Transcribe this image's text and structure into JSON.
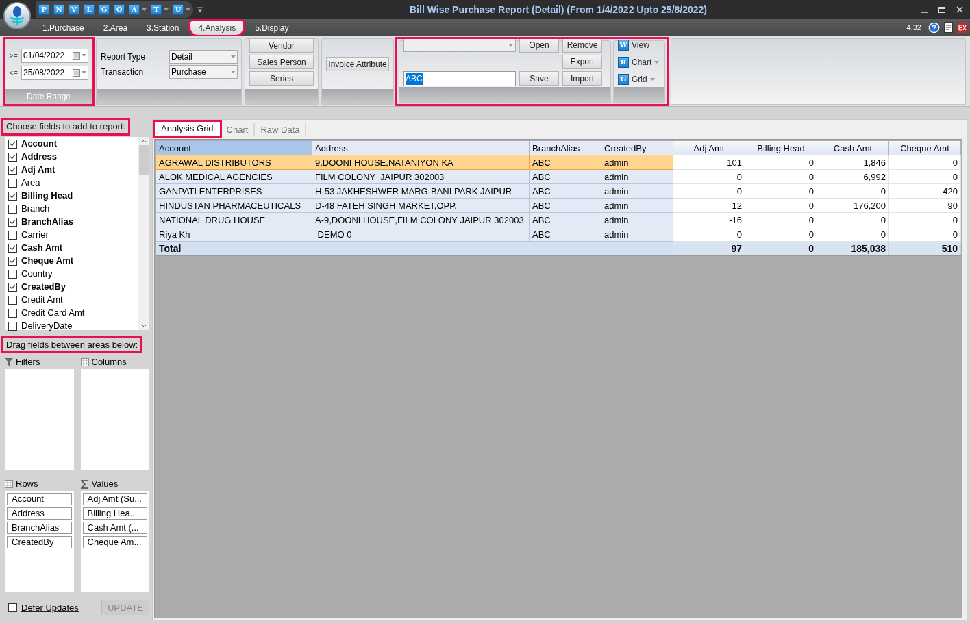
{
  "window": {
    "title": "Bill Wise Purchase Report (Detail) (From 1/4/2022 Upto 25/8/2022)",
    "version": "4.32"
  },
  "quick_access": [
    {
      "letter": "P",
      "dropdown": false
    },
    {
      "letter": "N",
      "dropdown": false
    },
    {
      "letter": "V",
      "dropdown": false
    },
    {
      "letter": "L",
      "dropdown": false
    },
    {
      "letter": "G",
      "dropdown": false
    },
    {
      "letter": "O",
      "dropdown": false
    },
    {
      "letter": "A",
      "dropdown": true
    },
    {
      "letter": "T",
      "dropdown": true
    },
    {
      "letter": "U",
      "dropdown": true
    }
  ],
  "ribbon_tabs": [
    {
      "label": "1.Purchase",
      "selected": false
    },
    {
      "label": "2.Area",
      "selected": false
    },
    {
      "label": "3.Station",
      "selected": false
    },
    {
      "label": "4.Analysis",
      "selected": true
    },
    {
      "label": "5.Display",
      "selected": false
    }
  ],
  "date_range": {
    "label": "Date Range",
    "from_op": ">=",
    "from": "01/04/2022",
    "to_op": "<=",
    "to": "25/08/2022"
  },
  "report": {
    "report_type_label": "Report Type",
    "report_type": "Detail",
    "transaction_label": "Transaction",
    "transaction": "Purchase"
  },
  "filter_buttons": [
    "Vendor",
    "Sales Person",
    "Series"
  ],
  "invoice_button": "Invoice Attribute",
  "layout": {
    "name_value": "ABC",
    "open": "Open",
    "save": "Save",
    "remove": "Remove",
    "export": "Export",
    "import": "Import"
  },
  "view_buttons": [
    {
      "label": "View",
      "letter": "W",
      "dropdown": false
    },
    {
      "label": "Chart",
      "letter": "R",
      "dropdown": true
    },
    {
      "label": "Grid",
      "letter": "G",
      "dropdown": true
    }
  ],
  "field_list": {
    "title": "Choose fields to add to report:",
    "items": [
      {
        "label": "Account",
        "checked": true
      },
      {
        "label": "Address",
        "checked": true
      },
      {
        "label": "Adj Amt",
        "checked": true
      },
      {
        "label": "Area",
        "checked": false
      },
      {
        "label": "Billing Head",
        "checked": true
      },
      {
        "label": "Branch",
        "checked": false
      },
      {
        "label": "BranchAlias",
        "checked": true
      },
      {
        "label": "Carrier",
        "checked": false
      },
      {
        "label": "Cash Amt",
        "checked": true
      },
      {
        "label": "Cheque Amt",
        "checked": true
      },
      {
        "label": "Country",
        "checked": false
      },
      {
        "label": "CreatedBy",
        "checked": true
      },
      {
        "label": "Credit Amt",
        "checked": false
      },
      {
        "label": "Credit Card Amt",
        "checked": false
      },
      {
        "label": "DeliveryDate",
        "checked": false
      }
    ]
  },
  "areas": {
    "title": "Drag fields between areas below:",
    "filters": {
      "label": "Filters"
    },
    "columns": {
      "label": "Columns"
    },
    "rows": {
      "label": "Rows",
      "items": [
        "Account",
        "Address",
        "BranchAlias",
        "CreatedBy"
      ]
    },
    "values": {
      "label": "Values",
      "items": [
        "Adj Amt (Su...",
        "Billing Hea...",
        "Cash Amt (...",
        "Cheque Am..."
      ]
    }
  },
  "defer_updates": {
    "label": "Defer Updates",
    "checked": false
  },
  "update_button": {
    "label": "UPDATE",
    "disabled": true
  },
  "view_tabs": [
    {
      "label": "Analysis Grid",
      "selected": true
    },
    {
      "label": "Chart",
      "selected": false
    },
    {
      "label": "Raw Data",
      "selected": false
    }
  ],
  "grid": {
    "columns": [
      "Account",
      "Address",
      "BranchAlias",
      "CreatedBy",
      "Adj Amt",
      "Billing Head",
      "Cash Amt",
      "Cheque Amt"
    ],
    "rows": [
      {
        "selected": true,
        "cells": [
          "AGRAWAL DISTRIBUTORS",
          "9,DOONI HOUSE,NATANIYON KA",
          "ABC",
          "admin",
          "101",
          "0",
          "1,846",
          "0"
        ]
      },
      {
        "selected": false,
        "cells": [
          "ALOK MEDICAL AGENCIES",
          "FILM COLONY  JAIPUR 302003",
          "ABC",
          "admin",
          "0",
          "0",
          "6,992",
          "0"
        ]
      },
      {
        "selected": false,
        "cells": [
          "GANPATI ENTERPRISES",
          "H-53 JAKHESHWER MARG-BANI PARK JAIPUR",
          "ABC",
          "admin",
          "0",
          "0",
          "0",
          "420"
        ]
      },
      {
        "selected": false,
        "cells": [
          "HINDUSTAN PHARMACEUTICALS",
          "D-48 FATEH SINGH MARKET,OPP.",
          "ABC",
          "admin",
          "12",
          "0",
          "176,200",
          "90"
        ]
      },
      {
        "selected": false,
        "cells": [
          "NATIONAL DRUG HOUSE",
          "A-9,DOONI HOUSE,FILM COLONY JAIPUR 302003",
          "ABC",
          "admin",
          "-16",
          "0",
          "0",
          "0"
        ]
      },
      {
        "selected": false,
        "cells": [
          "Riya Kh",
          " DEMO 0",
          "ABC",
          "admin",
          "0",
          "0",
          "0",
          "0"
        ]
      }
    ],
    "total": {
      "label": "Total",
      "values": [
        "97",
        "0",
        "185,038",
        "510"
      ]
    }
  }
}
